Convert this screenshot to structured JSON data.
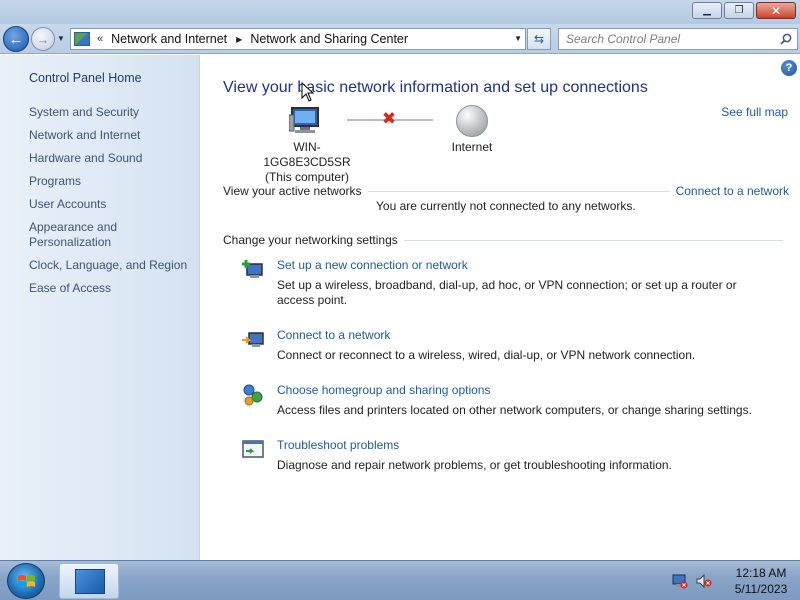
{
  "window": {
    "minimize_icon": "minimize-icon",
    "maximize_icon": "maximize-icon",
    "close_icon": "close-icon"
  },
  "navigation": {
    "breadcrumb_chevron": "«",
    "breadcrumbs": [
      "Network and Internet",
      "Network and Sharing Center"
    ],
    "search_placeholder": "Search Control Panel"
  },
  "sidebar": {
    "home": "Control Panel Home",
    "items": [
      "System and Security",
      "Network and Internet",
      "Hardware and Sound",
      "Programs",
      "User Accounts",
      "Appearance and Personalization",
      "Clock, Language, and Region",
      "Ease of Access"
    ]
  },
  "main": {
    "help_label": "?",
    "title": "View your basic network information and set up connections",
    "see_full_map": "See full map",
    "computer_name": "WIN-1GG8E3CD5SR",
    "computer_sub": "(This computer)",
    "internet_label": "Internet",
    "active_networks_label": "View your active networks",
    "connect_link": "Connect to a network",
    "not_connected": "You are currently not connected to any networks.",
    "change_settings_label": "Change your networking settings",
    "tasks": [
      {
        "title": "Set up a new connection or network",
        "desc": "Set up a wireless, broadband, dial-up, ad hoc, or VPN connection; or set up a router or access point."
      },
      {
        "title": "Connect to a network",
        "desc": "Connect or reconnect to a wireless, wired, dial-up, or VPN network connection."
      },
      {
        "title": "Choose homegroup and sharing options",
        "desc": "Access files and printers located on other network computers, or change sharing settings."
      },
      {
        "title": "Troubleshoot problems",
        "desc": "Diagnose and repair network problems, or get troubleshooting information."
      }
    ]
  },
  "taskbar": {
    "time": "12:18 AM",
    "date": "5/11/2023"
  }
}
